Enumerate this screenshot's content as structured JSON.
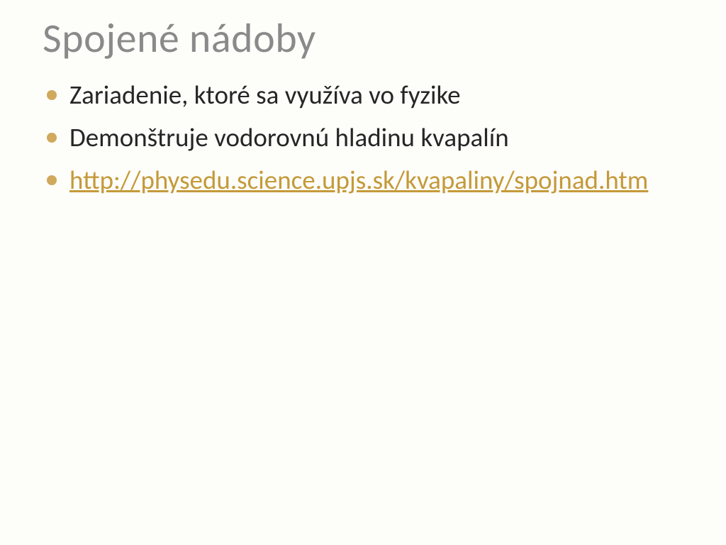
{
  "slide": {
    "title": "Spojené nádoby",
    "bullets": [
      {
        "text": "Zariadenie,  ktoré sa využíva vo fyzike",
        "is_link": false
      },
      {
        "text": "Demonštruje vodorovnú hladinu kvapalín",
        "is_link": false
      },
      {
        "text": "http://physedu.science.upjs.sk/kvapaliny/spojnad.htm",
        "is_link": true
      }
    ]
  },
  "colors": {
    "title_gray": "#8a8a8a",
    "bullet_gold": "#d0a95c",
    "link_gold": "#c49a3a",
    "background": "#fdfdfa",
    "body_text": "#262626"
  }
}
